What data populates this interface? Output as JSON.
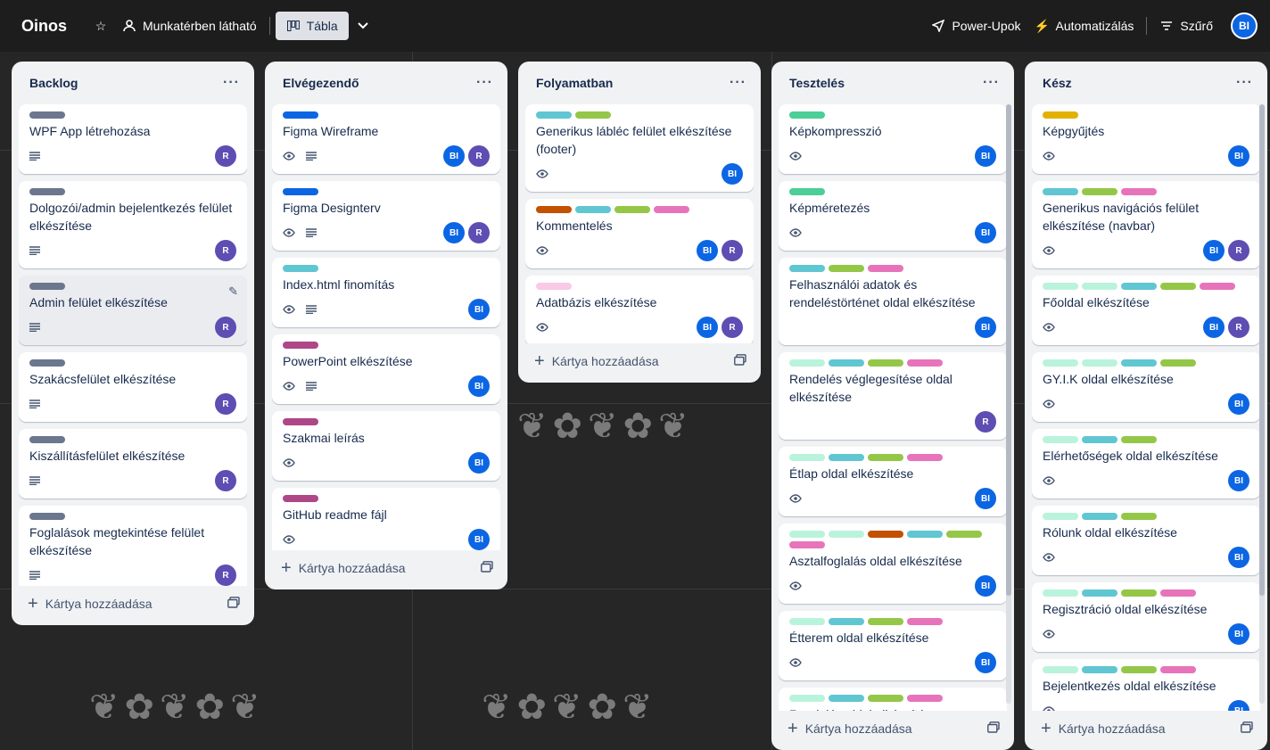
{
  "board": {
    "title": "Oinos",
    "visibility_label": "Munkatérben látható",
    "view_label": "Tábla",
    "powerups_label": "Power-Upok",
    "automation_label": "Automatizálás",
    "filter_label": "Szűrő",
    "user_initials": "BI"
  },
  "add_card_label": "Kártya hozzáadása",
  "colors": {
    "gray": "#6b778c",
    "blue": "#0c66e4",
    "teal": "#60c6d2",
    "lime": "#94c748",
    "pink": "#e774bb",
    "magenta": "#ae4787",
    "brown": "#c25100",
    "green": "#4bce97",
    "yellow": "#e2b203",
    "mint": "#baf3db",
    "lightpink": "#f9c9e6"
  },
  "lists": [
    {
      "title": "Backlog",
      "cards": [
        {
          "labels": [
            "gray"
          ],
          "title": "WPF App létrehozása",
          "desc": true,
          "watch": false,
          "members": [
            "R"
          ]
        },
        {
          "labels": [
            "gray"
          ],
          "title": "Dolgozói/admin bejelentkezés felület elkészítése",
          "desc": true,
          "watch": false,
          "members": [
            "R"
          ]
        },
        {
          "labels": [
            "gray"
          ],
          "title": "Admin felület elkészítése",
          "desc": true,
          "watch": false,
          "members": [
            "R"
          ],
          "hover": true
        },
        {
          "labels": [
            "gray"
          ],
          "title": "Szakácsfelület elkészítése",
          "desc": true,
          "watch": false,
          "members": [
            "R"
          ]
        },
        {
          "labels": [
            "gray"
          ],
          "title": "Kiszállításfelület elkészítése",
          "desc": true,
          "watch": false,
          "members": [
            "R"
          ]
        },
        {
          "labels": [
            "gray"
          ],
          "title": "Foglalások megtekintése felület elkészítése",
          "desc": true,
          "watch": false,
          "members": [
            "R"
          ]
        }
      ]
    },
    {
      "title": "Elvégezendő",
      "cards": [
        {
          "labels": [
            "blue"
          ],
          "title": "Figma Wireframe",
          "desc": true,
          "watch": true,
          "members": [
            "BI",
            "R"
          ]
        },
        {
          "labels": [
            "blue"
          ],
          "title": "Figma Designterv",
          "desc": true,
          "watch": true,
          "members": [
            "BI",
            "R"
          ]
        },
        {
          "labels": [
            "teal"
          ],
          "title": "Index.html finomítás",
          "desc": true,
          "watch": true,
          "members": [
            "BI"
          ]
        },
        {
          "labels": [
            "magenta"
          ],
          "title": "PowerPoint elkészítése",
          "desc": true,
          "watch": true,
          "members": [
            "BI"
          ]
        },
        {
          "labels": [
            "magenta"
          ],
          "title": "Szakmai leírás",
          "desc": false,
          "watch": true,
          "members": [
            "BI"
          ]
        },
        {
          "labels": [
            "magenta"
          ],
          "title": "GitHub readme fájl",
          "desc": false,
          "watch": true,
          "members": [
            "BI"
          ]
        }
      ]
    },
    {
      "title": "Folyamatban",
      "cards": [
        {
          "labels": [
            "teal",
            "lime"
          ],
          "title": "Generikus lábléc felület elkészítése (footer)",
          "desc": false,
          "watch": true,
          "members": [
            "BI"
          ]
        },
        {
          "labels": [
            "brown",
            "teal",
            "lime",
            "pink"
          ],
          "title": "Kommentelés",
          "desc": false,
          "watch": true,
          "members": [
            "BI",
            "R"
          ]
        },
        {
          "labels": [
            "lightpink"
          ],
          "title": "Adatbázis elkészítése",
          "desc": false,
          "watch": true,
          "members": [
            "BI",
            "R"
          ]
        }
      ]
    },
    {
      "title": "Tesztelés",
      "cards": [
        {
          "labels": [
            "green"
          ],
          "title": "Képkompresszió",
          "desc": false,
          "watch": true,
          "members": [
            "BI"
          ]
        },
        {
          "labels": [
            "green"
          ],
          "title": "Képméretezés",
          "desc": false,
          "watch": true,
          "members": [
            "BI"
          ]
        },
        {
          "labels": [
            "teal",
            "lime",
            "pink"
          ],
          "title": "Felhasználói adatok és rendeléstörténet oldal elkészítése",
          "desc": false,
          "watch": false,
          "members": [
            "BI"
          ]
        },
        {
          "labels": [
            "mint",
            "teal",
            "lime",
            "pink"
          ],
          "title": "Rendelés véglegesítése oldal elkészítése",
          "desc": false,
          "watch": false,
          "members": [
            "R"
          ]
        },
        {
          "labels": [
            "mint",
            "teal",
            "lime",
            "pink"
          ],
          "title": "Étlap oldal elkészítése",
          "desc": false,
          "watch": true,
          "members": [
            "BI"
          ]
        },
        {
          "labels": [
            "mint",
            "mint",
            "brown",
            "teal",
            "lime",
            "pink"
          ],
          "title": "Asztalfoglalás oldal elkészítése",
          "desc": false,
          "watch": true,
          "members": [
            "BI"
          ]
        },
        {
          "labels": [
            "mint",
            "teal",
            "lime",
            "pink"
          ],
          "title": "Étterem oldal elkészítése",
          "desc": false,
          "watch": true,
          "members": [
            "BI"
          ]
        },
        {
          "labels": [
            "mint",
            "teal",
            "lime",
            "pink"
          ],
          "title": "Rendelés oldal elkészítése",
          "desc": false,
          "watch": false,
          "members": []
        }
      ]
    },
    {
      "title": "Kész",
      "cards": [
        {
          "labels": [
            "yellow"
          ],
          "title": "Képgyűjtés",
          "desc": false,
          "watch": true,
          "members": [
            "BI"
          ]
        },
        {
          "labels": [
            "teal",
            "lime",
            "pink"
          ],
          "title": "Generikus navigációs felület elkészítése (navbar)",
          "desc": false,
          "watch": true,
          "members": [
            "BI",
            "R"
          ]
        },
        {
          "labels": [
            "mint",
            "mint",
            "teal",
            "lime",
            "pink"
          ],
          "title": "Főoldal elkészítése",
          "desc": false,
          "watch": true,
          "members": [
            "BI",
            "R"
          ]
        },
        {
          "labels": [
            "mint",
            "mint",
            "teal",
            "lime"
          ],
          "title": "GY.I.K oldal elkészítése",
          "desc": false,
          "watch": true,
          "members": [
            "BI"
          ]
        },
        {
          "labels": [
            "mint",
            "teal",
            "lime"
          ],
          "title": "Elérhetőségek oldal elkészítése",
          "desc": false,
          "watch": true,
          "members": [
            "BI"
          ]
        },
        {
          "labels": [
            "mint",
            "teal",
            "lime"
          ],
          "title": "Rólunk oldal elkészítése",
          "desc": false,
          "watch": true,
          "members": [
            "BI"
          ]
        },
        {
          "labels": [
            "mint",
            "teal",
            "lime",
            "pink"
          ],
          "title": "Regisztráció oldal elkészítése",
          "desc": false,
          "watch": true,
          "members": [
            "BI"
          ]
        },
        {
          "labels": [
            "mint",
            "teal",
            "lime",
            "pink"
          ],
          "title": "Bejelentkezés oldal elkészítése",
          "desc": false,
          "watch": true,
          "members": [
            "BI"
          ]
        }
      ]
    }
  ]
}
